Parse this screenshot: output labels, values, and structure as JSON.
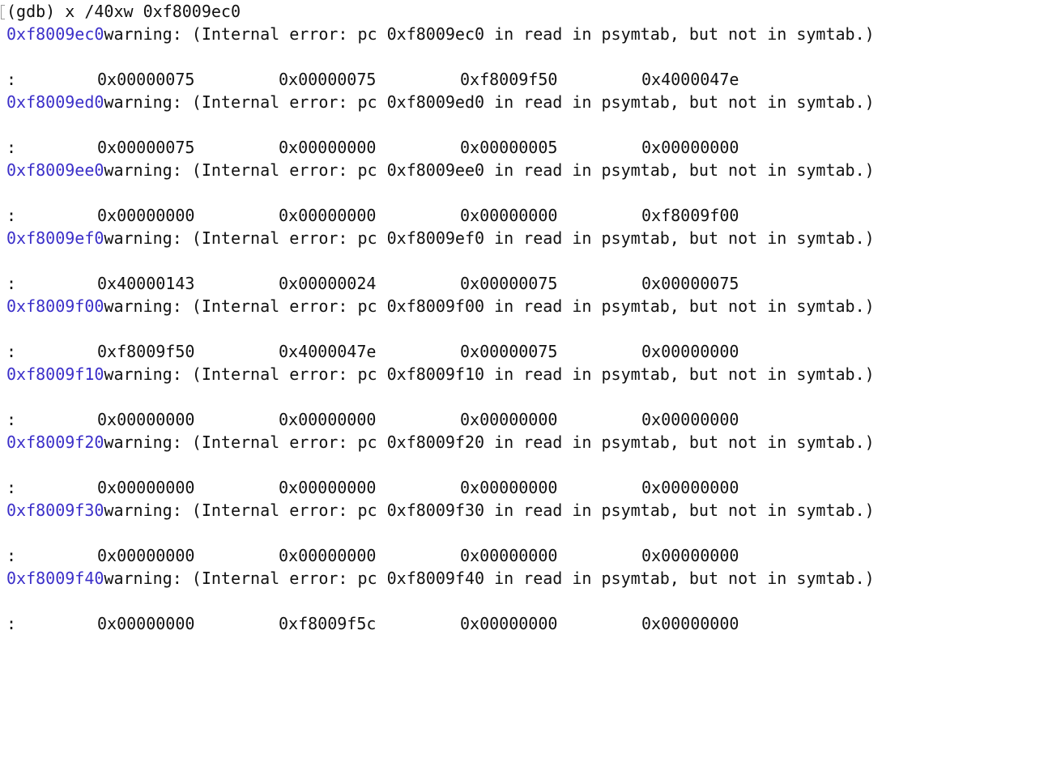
{
  "prompt": {
    "command": "(gdb) x /40xw 0xf8009ec0"
  },
  "colors": {
    "address": "#3b2fc9",
    "text": "#111111",
    "background": "#ffffff"
  },
  "blocks": [
    {
      "address": "0xf8009ec0",
      "warning": "warning: (Internal error: pc 0xf8009ec0 in read in psymtab, but not in symtab.)",
      "colon": ":",
      "words": [
        "0x00000075",
        "0x00000075",
        "0xf8009f50",
        "0x4000047e"
      ]
    },
    {
      "address": "0xf8009ed0",
      "warning": "warning: (Internal error: pc 0xf8009ed0 in read in psymtab, but not in symtab.)",
      "colon": ":",
      "words": [
        "0x00000075",
        "0x00000000",
        "0x00000005",
        "0x00000000"
      ]
    },
    {
      "address": "0xf8009ee0",
      "warning": "warning: (Internal error: pc 0xf8009ee0 in read in psymtab, but not in symtab.)",
      "colon": ":",
      "words": [
        "0x00000000",
        "0x00000000",
        "0x00000000",
        "0xf8009f00"
      ]
    },
    {
      "address": "0xf8009ef0",
      "warning": "warning: (Internal error: pc 0xf8009ef0 in read in psymtab, but not in symtab.)",
      "colon": ":",
      "words": [
        "0x40000143",
        "0x00000024",
        "0x00000075",
        "0x00000075"
      ]
    },
    {
      "address": "0xf8009f00",
      "warning": "warning: (Internal error: pc 0xf8009f00 in read in psymtab, but not in symtab.)",
      "colon": ":",
      "words": [
        "0xf8009f50",
        "0x4000047e",
        "0x00000075",
        "0x00000000"
      ]
    },
    {
      "address": "0xf8009f10",
      "warning": "warning: (Internal error: pc 0xf8009f10 in read in psymtab, but not in symtab.)",
      "colon": ":",
      "words": [
        "0x00000000",
        "0x00000000",
        "0x00000000",
        "0x00000000"
      ]
    },
    {
      "address": "0xf8009f20",
      "warning": "warning: (Internal error: pc 0xf8009f20 in read in psymtab, but not in symtab.)",
      "colon": ":",
      "words": [
        "0x00000000",
        "0x00000000",
        "0x00000000",
        "0x00000000"
      ]
    },
    {
      "address": "0xf8009f30",
      "warning": "warning: (Internal error: pc 0xf8009f30 in read in psymtab, but not in symtab.)",
      "colon": ":",
      "words": [
        "0x00000000",
        "0x00000000",
        "0x00000000",
        "0x00000000"
      ]
    },
    {
      "address": "0xf8009f40",
      "warning": "warning: (Internal error: pc 0xf8009f40 in read in psymtab, but not in symtab.)",
      "colon": ":",
      "words": [
        "0x00000000",
        "0xf8009f5c",
        "0x00000000",
        "0x00000000"
      ]
    }
  ]
}
